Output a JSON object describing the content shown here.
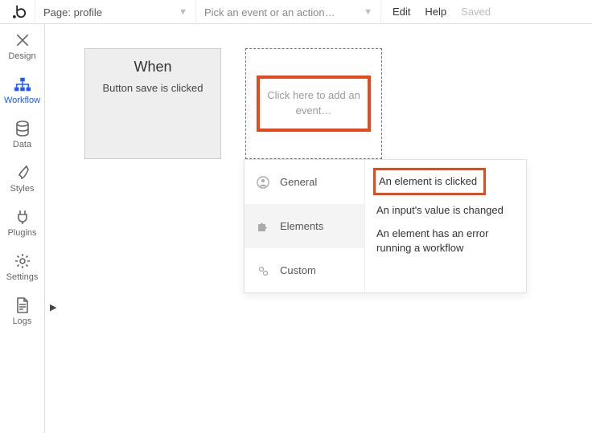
{
  "topbar": {
    "page_label": "Page:",
    "page_value": "profile",
    "picker_placeholder": "Pick an event or an action…",
    "menu": {
      "edit": "Edit",
      "help": "Help",
      "saved": "Saved"
    }
  },
  "sidebar": {
    "items": [
      {
        "label": "Design"
      },
      {
        "label": "Workflow"
      },
      {
        "label": "Data"
      },
      {
        "label": "Styles"
      },
      {
        "label": "Plugins"
      },
      {
        "label": "Settings"
      },
      {
        "label": "Logs"
      }
    ]
  },
  "canvas": {
    "card": {
      "when": "When",
      "desc": "Button save is clicked"
    },
    "add_placeholder": "Click here to add an event…"
  },
  "dropdown": {
    "categories": [
      {
        "label": "General"
      },
      {
        "label": "Elements"
      },
      {
        "label": "Custom"
      }
    ],
    "options": [
      "An element is clicked",
      "An input's value is changed",
      "An element has an error running a workflow"
    ]
  }
}
